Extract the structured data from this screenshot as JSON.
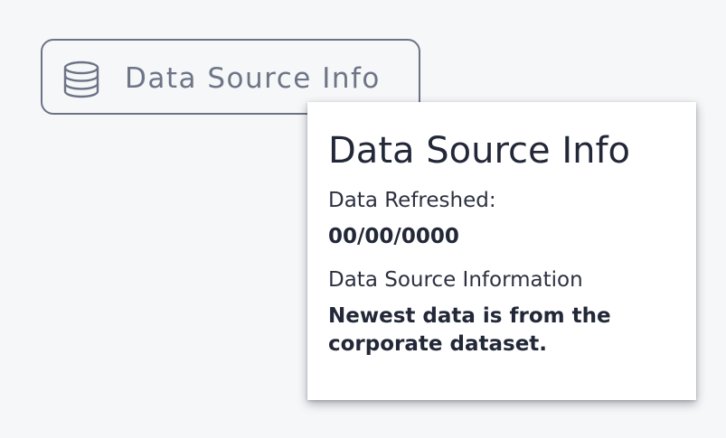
{
  "trigger": {
    "icon": "database-icon",
    "label": "Data Source Info"
  },
  "popover": {
    "title": "Data Source Info",
    "refreshed_label": "Data Refreshed:",
    "refreshed_value": "00/00/0000",
    "source_label": "Data Source Information",
    "source_value": "Newest data is from the corporate dataset."
  },
  "colors": {
    "page_background": "#f6f7f9",
    "button_border": "#6b7385",
    "button_text": "#6d7587",
    "popover_background": "#ffffff",
    "popover_text": "#232838"
  }
}
